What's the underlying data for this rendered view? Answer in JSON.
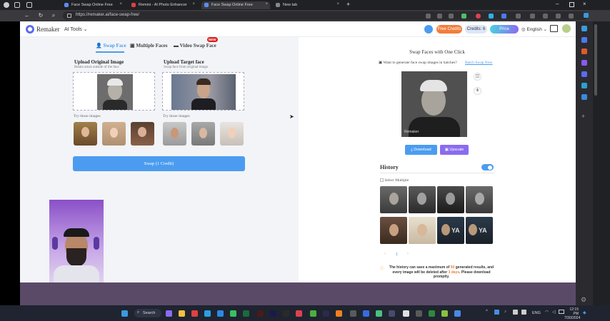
{
  "browser": {
    "tabs": [
      {
        "title": "Face Swap Online Free",
        "active": false
      },
      {
        "title": "Remini - AI Photo Enhancer",
        "active": false
      },
      {
        "title": "Face Swap Online Free",
        "active": true
      },
      {
        "title": "New tab",
        "active": false
      }
    ],
    "url": "https://remaker.ai/face-swap-free/"
  },
  "header": {
    "brand": "Remaker",
    "ai_tools": "AI Tools",
    "free_credits": "Free Credits",
    "credits": "Credits: 6",
    "price": "Price",
    "language": "English"
  },
  "modes": {
    "swap_face": "Swap Face",
    "multiple_faces": "Multiple Faces",
    "video_swap_face": "Video Swap Face",
    "new_badge": "NEW"
  },
  "upload": {
    "original_title": "Upload Original Image",
    "original_sub": "Retain areas outside of the face",
    "target_title": "Upload Target face",
    "target_sub": "Swap face from original image",
    "try_label_left": "Try those images",
    "try_label_right": "Try those images",
    "swap_button": "Swap (1 Credit)"
  },
  "result": {
    "title": "Swap Faces with One Click",
    "batch_prompt": "Want to generate face swap images in batches?",
    "batch_link": "Batch Swap Now",
    "watermark": "Remaker",
    "download": "Download",
    "upscale": "Upscale"
  },
  "history": {
    "title": "History",
    "select_multiple": "Select Multiple",
    "page": "1",
    "note_prefix": "The history can save a maximum of ",
    "note_max": "50",
    "note_mid": " generated results, and every image will be deleted after ",
    "note_days": "3 days",
    "note_suffix": ". Please download promptly."
  },
  "overlay_caption": "",
  "taskbar": {
    "search": "Search",
    "lang": "ENG",
    "time": "12:15 PM",
    "date": "7/30/2024"
  },
  "colors": {
    "accent_blue": "#4b9cf0",
    "free_credits": "#f07d3c",
    "price_gradient": "#4ad0e0",
    "upscale_purple": "#8a6cf0"
  }
}
